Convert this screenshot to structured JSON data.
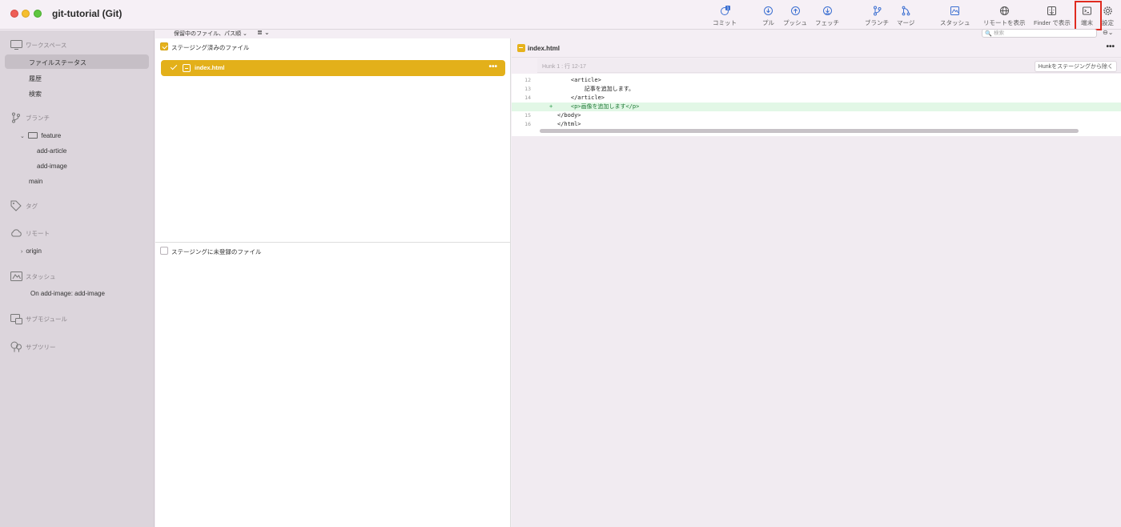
{
  "window": {
    "title": "git-tutorial (Git)"
  },
  "toolbar": {
    "commit": "コミット",
    "commit_badge": "1",
    "pull": "プル",
    "push": "プッシュ",
    "fetch": "フェッチ",
    "branch": "ブランチ",
    "merge": "マージ",
    "stash": "スタッシュ",
    "show_remote": "リモートを表示",
    "show_finder": "Finder で表示",
    "terminal": "端末",
    "settings": "設定",
    "search_placeholder": "検索"
  },
  "sidebar": {
    "workspace": "ワークスペース",
    "file_status": "ファイルステータス",
    "history": "履歴",
    "search": "検索",
    "branches": "ブランチ",
    "folder_feature": "feature",
    "branch_add_article": "add-article",
    "branch_add_image": "add-image",
    "branch_main": "main",
    "tags": "タグ",
    "remotes": "リモート",
    "remote_origin": "origin",
    "stashes": "スタッシュ",
    "stash_item": "On add-image: add-image",
    "submodules": "サブモジュール",
    "subtrees": "サブツリー"
  },
  "files": {
    "sort_label": "保留中のファイル、パス順",
    "staged_header": "ステージング済みのファイル",
    "staged_file": "index.html",
    "unstaged_header": "ステージングに未登録のファイル"
  },
  "diff": {
    "file_name": "index.html",
    "hunk_title": "Hunk 1 : 行 12-17",
    "unstage_hunk_button": "Hunkをステージングから除く",
    "lines": [
      {
        "num": "12",
        "marker": "",
        "text": "    <article>"
      },
      {
        "num": "13",
        "marker": "",
        "text": "        記事を追加します。"
      },
      {
        "num": "14",
        "marker": "",
        "text": "    </article>"
      },
      {
        "num": "",
        "marker": "+",
        "text": "    <p>画像を追加します</p>"
      },
      {
        "num": "15",
        "marker": "",
        "text": "</body>"
      },
      {
        "num": "16",
        "marker": "",
        "text": "</html>"
      }
    ]
  }
}
